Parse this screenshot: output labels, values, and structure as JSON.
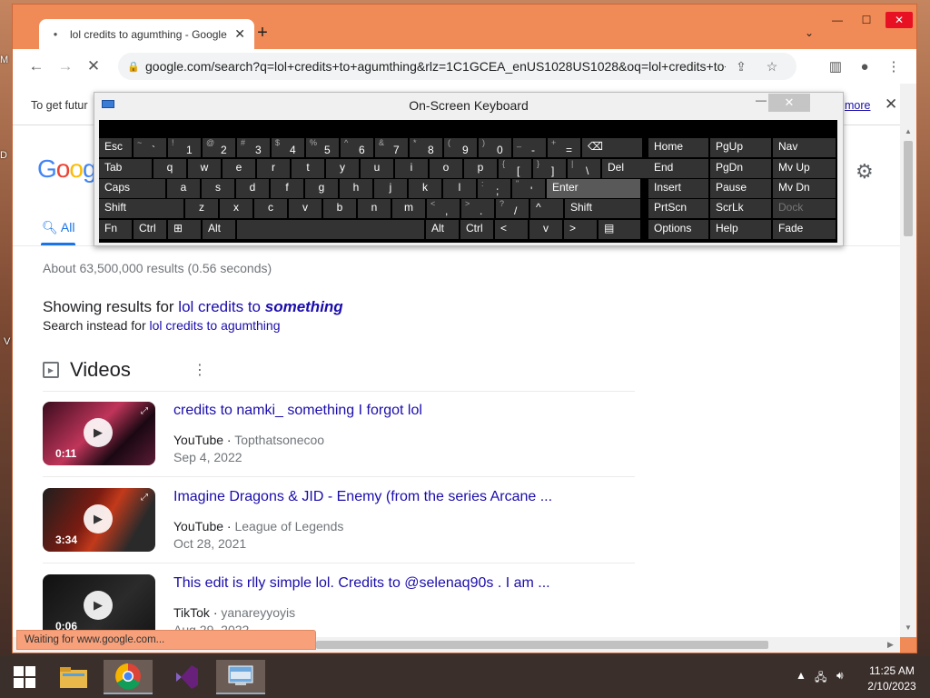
{
  "desktop": {
    "edge_letters": [
      "M",
      "D",
      "V"
    ]
  },
  "browser": {
    "tab": {
      "title": "lol credits to agumthing - Google"
    },
    "window_controls": {
      "minimize": "—",
      "maximize": "☐",
      "close": "✕"
    },
    "url": "google.com/search?q=lol+credits+to+agumthing&rlz=1C1GCEA_enUS1028US1028&oq=lol+credits+to+a...",
    "status": "Waiting for www.google.com..."
  },
  "page": {
    "infobar": {
      "text": "To get futur",
      "more": "more"
    },
    "logo": "Goog",
    "tabs": {
      "all": "All"
    },
    "stats": "About 63,500,000 results (0.56 seconds)",
    "showing_prefix": "Showing results for ",
    "showing_query": "lol credits to ",
    "showing_query_bold": "something",
    "instead_prefix": "Search instead for ",
    "instead_query": "lol credits to agumthing",
    "videos_heading": "Videos",
    "videos": [
      {
        "title": "credits to namki_ something I forgot lol",
        "source": "YouTube",
        "channel": "Topthatsonecoo",
        "date": "Sep 4, 2022",
        "duration": "0:11"
      },
      {
        "title": "Imagine Dragons & JID - Enemy (from the series Arcane ...",
        "source": "YouTube",
        "channel": "League of Legends",
        "date": "Oct 28, 2021",
        "duration": "3:34"
      },
      {
        "title": "This edit is rlly simple lol. Credits to @selenaq90s . I am ...",
        "source": "TikTok",
        "channel": "yanareyyoyis",
        "date": "Aug 29, 2022",
        "duration": "0:06"
      }
    ]
  },
  "osk": {
    "title": "On-Screen Keyboard",
    "rows": [
      [
        [
          "Esc",
          ""
        ],
        [
          "`",
          "~"
        ],
        [
          "1",
          "!"
        ],
        [
          "2",
          "@"
        ],
        [
          "3",
          "#"
        ],
        [
          "4",
          "$"
        ],
        [
          "5",
          "%"
        ],
        [
          "6",
          "^"
        ],
        [
          "7",
          "&"
        ],
        [
          "8",
          "*"
        ],
        [
          "9",
          "("
        ],
        [
          "0",
          ")"
        ],
        [
          "-",
          "_"
        ],
        [
          "=",
          "+"
        ],
        [
          "⌫",
          ""
        ]
      ],
      [
        [
          "Tab",
          ""
        ],
        [
          "q",
          ""
        ],
        [
          "w",
          ""
        ],
        [
          "e",
          ""
        ],
        [
          "r",
          ""
        ],
        [
          "t",
          ""
        ],
        [
          "y",
          ""
        ],
        [
          "u",
          ""
        ],
        [
          "i",
          ""
        ],
        [
          "o",
          ""
        ],
        [
          "p",
          ""
        ],
        [
          "[",
          "{"
        ],
        [
          "]",
          "}"
        ],
        [
          "\\",
          "|"
        ],
        [
          "Del",
          ""
        ]
      ],
      [
        [
          "Caps",
          ""
        ],
        [
          "a",
          ""
        ],
        [
          "s",
          ""
        ],
        [
          "d",
          ""
        ],
        [
          "f",
          ""
        ],
        [
          "g",
          ""
        ],
        [
          "h",
          ""
        ],
        [
          "j",
          ""
        ],
        [
          "k",
          ""
        ],
        [
          "l",
          ""
        ],
        [
          ";",
          ":"
        ],
        [
          "'",
          "\""
        ],
        [
          "Enter",
          ""
        ]
      ],
      [
        [
          "Shift",
          ""
        ],
        [
          "z",
          ""
        ],
        [
          "x",
          ""
        ],
        [
          "c",
          ""
        ],
        [
          "v",
          ""
        ],
        [
          "b",
          ""
        ],
        [
          "n",
          ""
        ],
        [
          "m",
          ""
        ],
        [
          ",",
          "<"
        ],
        [
          ".",
          ">"
        ],
        [
          "/",
          "?"
        ],
        [
          "^",
          ""
        ],
        [
          "Shift",
          ""
        ]
      ],
      [
        [
          "Fn",
          ""
        ],
        [
          "Ctrl",
          ""
        ],
        [
          "⊞",
          ""
        ],
        [
          "Alt",
          ""
        ],
        [
          "",
          ""
        ],
        [
          "Alt",
          ""
        ],
        [
          "Ctrl",
          ""
        ],
        [
          "<",
          ""
        ],
        [
          "v",
          ""
        ],
        [
          ">",
          ""
        ],
        [
          "▤",
          ""
        ]
      ]
    ],
    "nav": [
      [
        "Home",
        "PgUp",
        "Nav"
      ],
      [
        "End",
        "PgDn",
        "Mv Up"
      ],
      [
        "Insert",
        "Pause",
        "Mv Dn"
      ],
      [
        "PrtScn",
        "ScrLk",
        "Dock"
      ],
      [
        "Options",
        "Help",
        "Fade"
      ]
    ]
  },
  "taskbar": {
    "time": "11:25 AM",
    "date": "2/10/2023"
  },
  "colors": {
    "accent": "#1a73e8",
    "link": "#1a0dab",
    "chrome_frame": "#f08b58"
  }
}
